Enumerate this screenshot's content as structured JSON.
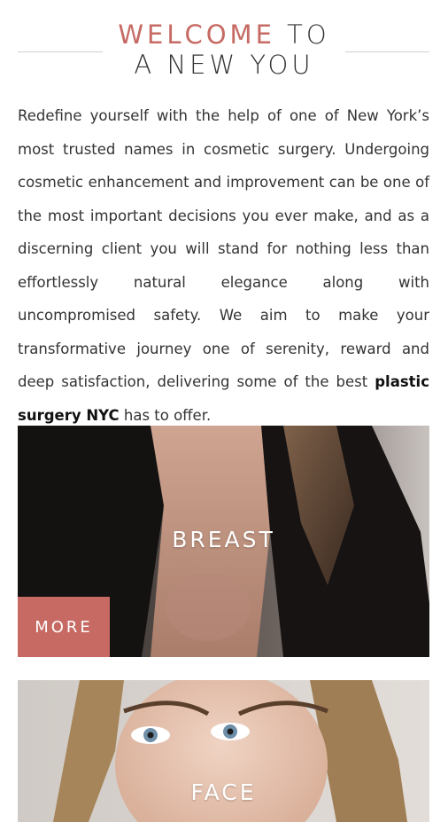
{
  "header": {
    "welcome": "WELCOME",
    "to": "TO",
    "subtitle": "A NEW YOU"
  },
  "intro": {
    "text_before": "Redefine yourself with the help of one of New York’s most trusted names in cosmetic surgery. Undergoing cosmetic enhancement and improvement can be one of the most important decisions you ever make, and as a discerning client you will stand for nothing less than effortlessly natural elegance along with uncompromised safety. We aim to make your transformative journey one of serenity, reward and deep satisfaction, delivering some of the best ",
    "link_text": "plastic surgery NYC",
    "text_after": " has to offer."
  },
  "cards": [
    {
      "label": "BREAST",
      "button": "MORE"
    },
    {
      "label": "FACE"
    }
  ],
  "colors": {
    "accent": "#c66a63",
    "text": "#333333"
  }
}
